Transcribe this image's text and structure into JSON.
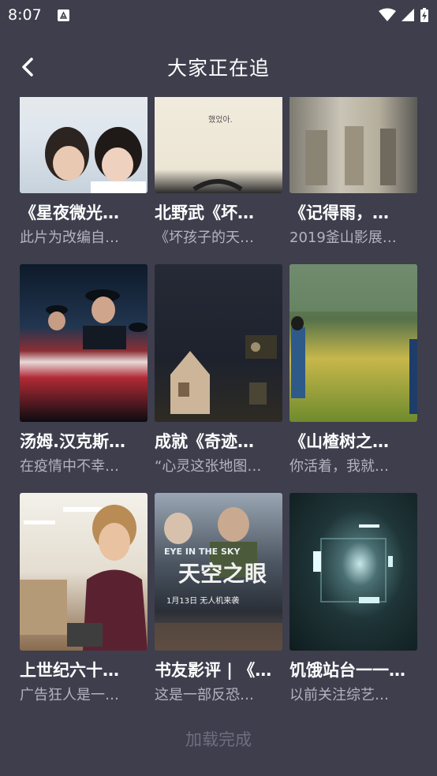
{
  "status_bar": {
    "time": "8:07"
  },
  "header": {
    "title": "大家正在追"
  },
  "cards": [
    {
      "title": "《星夜微光…",
      "desc": "此片为改编自…"
    },
    {
      "title": "北野武《坏…",
      "desc": "《坏孩子的天…"
    },
    {
      "title": "《记得雨，…",
      "desc": "2019釜山影展…"
    },
    {
      "title": "汤姆.汉克斯…",
      "desc": "在疫情中不幸…"
    },
    {
      "title": "成就《奇迹…",
      "desc": "“心灵这张地图…"
    },
    {
      "title": "《山楂树之…",
      "desc": "你活着，我就…"
    },
    {
      "title": "上世纪六十…",
      "desc": "广告狂人是一…"
    },
    {
      "title": "书友影评 | 《…",
      "desc": "这是一部反恐…"
    },
    {
      "title": "饥饿站台一一…",
      "desc": "以前关注综艺…"
    }
  ],
  "poster_text": {
    "eye_in_the_sky_en": "EYE IN THE SKY",
    "eye_in_the_sky_cn": "天空之眼",
    "eye_in_the_sky_date": "1月13日  无人机来袭",
    "row0_col1_text": "했었아."
  },
  "footer": {
    "load_status": "加载完成"
  }
}
